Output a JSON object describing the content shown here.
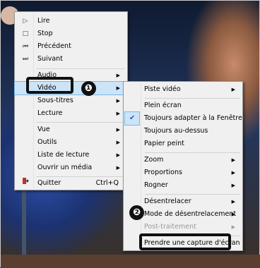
{
  "main_menu": {
    "items": [
      {
        "label": "Lire",
        "icon": "play-icon",
        "glyph": "▷",
        "has_submenu": false
      },
      {
        "label": "Stop",
        "icon": "stop-icon",
        "glyph": "□",
        "has_submenu": false
      },
      {
        "label": "Précédent",
        "icon": "previous-icon",
        "glyph": "⏮",
        "has_submenu": false
      },
      {
        "label": "Suivant",
        "icon": "next-icon",
        "glyph": "⏭",
        "has_submenu": false
      },
      {
        "label": "Audio",
        "has_submenu": true
      },
      {
        "label": "Vidéo",
        "has_submenu": true,
        "selected": true
      },
      {
        "label": "Sous-titres",
        "has_submenu": true
      },
      {
        "label": "Lecture",
        "has_submenu": true
      },
      {
        "label": "Vue",
        "has_submenu": true
      },
      {
        "label": "Outils",
        "has_submenu": true
      },
      {
        "label": "Liste de lecture",
        "has_submenu": true
      },
      {
        "label": "Ouvrir un média",
        "has_submenu": true
      },
      {
        "label": "Quitter",
        "icon": "quit-icon",
        "shortcut": "Ctrl+Q"
      }
    ]
  },
  "video_submenu": {
    "items": [
      {
        "label": "Piste vidéo",
        "has_submenu": true
      },
      {
        "label": "Plein écran"
      },
      {
        "label": "Toujours adapter à la Fenêtre",
        "checked": true
      },
      {
        "label": "Toujours au-dessus"
      },
      {
        "label": "Papier peint"
      },
      {
        "label": "Zoom",
        "has_submenu": true
      },
      {
        "label": "Proportions",
        "has_submenu": true
      },
      {
        "label": "Rogner",
        "has_submenu": true
      },
      {
        "label": "Désentrelacer",
        "has_submenu": true
      },
      {
        "label": "Mode de désentrelacement",
        "has_submenu": true
      },
      {
        "label": "Post-traitement",
        "has_submenu": true,
        "disabled": true
      },
      {
        "label": "Prendre une capture d'écran",
        "highlighted": true
      }
    ]
  },
  "annotations": {
    "badge1": "❶",
    "badge2": "❷"
  },
  "colors": {
    "menu_bg": "#f0f0f0",
    "highlight": "#cce4f7",
    "highlight_border": "#7ab8e6",
    "callout": "#111111"
  }
}
